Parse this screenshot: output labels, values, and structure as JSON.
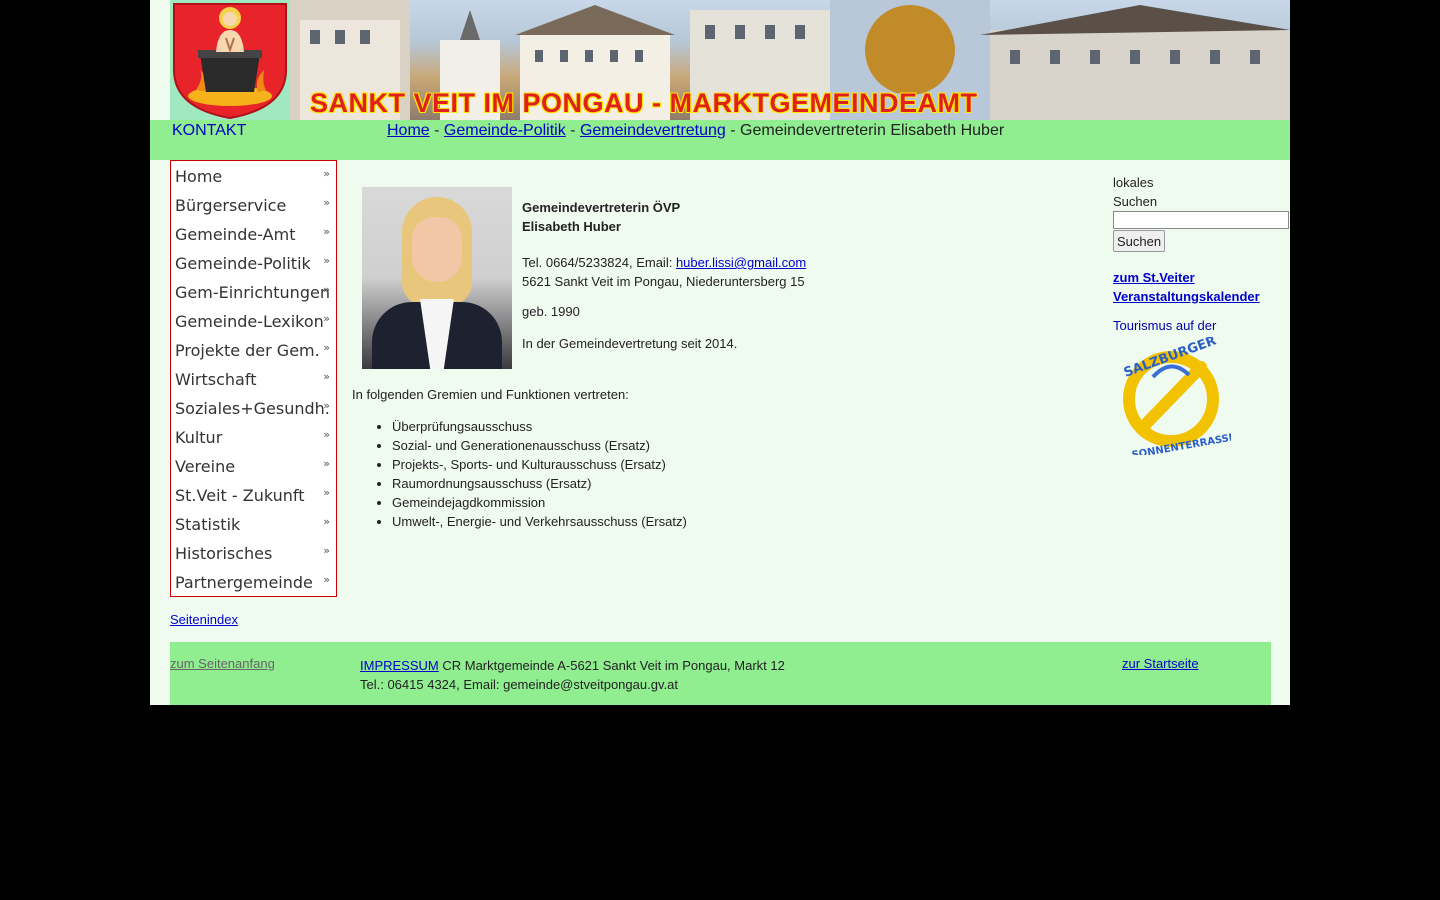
{
  "header": {
    "banner_title": "SANKT VEIT IM PONGAU - MARKTGEMEINDEAMT",
    "kontakt": "KONTAKT"
  },
  "breadcrumb": {
    "items": [
      "Home",
      "Gemeinde-Politik",
      "Gemeindevertretung"
    ],
    "separator": " - ",
    "current": "Gemeindevertreterin Elisabeth Huber"
  },
  "menu": {
    "items": [
      {
        "label": "Home"
      },
      {
        "label": "Bürgerservice"
      },
      {
        "label": "Gemeinde-Amt"
      },
      {
        "label": "Gemeinde-Politik"
      },
      {
        "label": "Gem-Einrichtungen"
      },
      {
        "label": "Gemeinde-Lexikon"
      },
      {
        "label": "Projekte der Gem."
      },
      {
        "label": "Wirtschaft"
      },
      {
        "label": "Soziales+Gesundh."
      },
      {
        "label": "Kultur"
      },
      {
        "label": "Vereine"
      },
      {
        "label": "St.Veit - Zukunft"
      },
      {
        "label": "Statistik"
      },
      {
        "label": "Historisches"
      },
      {
        "label": "Partnergemeinde"
      }
    ],
    "arrow": "»",
    "seitenindex": "Seitenindex"
  },
  "profile": {
    "title_line1": "Gemeindevertreterin ÖVP",
    "title_line2": "Elisabeth Huber",
    "phone_prefix": "Tel. 0664/5233824, Email: ",
    "email": "huber.lissi@gmail.com",
    "address": "5621 Sankt Veit im Pongau, Niederuntersberg 15",
    "born": "geb. 1990",
    "since": "In der Gemeindevertretung seit 2014."
  },
  "gremien": {
    "title": "In folgenden Gremien und Funktionen vertreten:",
    "items": [
      "Überprüfungsausschuss",
      "Sozial- und Generationenausschuss (Ersatz)",
      "Projekts-, Sports- und Kulturausschuss (Ersatz)",
      "Raumordnungsausschuss (Ersatz)",
      "Gemeindejagdkommission",
      "Umwelt-, Energie- und Verkehrsausschuss (Ersatz)"
    ]
  },
  "sidebar": {
    "search_label_line1": "lokales",
    "search_label_line2": "Suchen",
    "search_value": "",
    "search_button": "Suchen",
    "kalender_line1": "zum St.Veiter",
    "kalender_line2": "Veranstaltungskalender",
    "tourismus": "Tourismus auf der",
    "logo_text_top": "SALZBURGER",
    "logo_text_side": "SONNENTERRASSE"
  },
  "footer": {
    "to_top": "zum Seitenanfang",
    "impressum": "IMPRESSUM",
    "address": " CR Marktgemeinde A-5621 Sankt Veit im Pongau, Markt 12",
    "contact": "Tel.: 06415 4324, Email: gemeinde@stveitpongau.gv.at",
    "to_home": "zur Startseite"
  },
  "colors": {
    "green_bar": "#90ee90",
    "page_background": "#f0fbf0",
    "menu_border": "#cc0000",
    "link": "#0000cc"
  }
}
